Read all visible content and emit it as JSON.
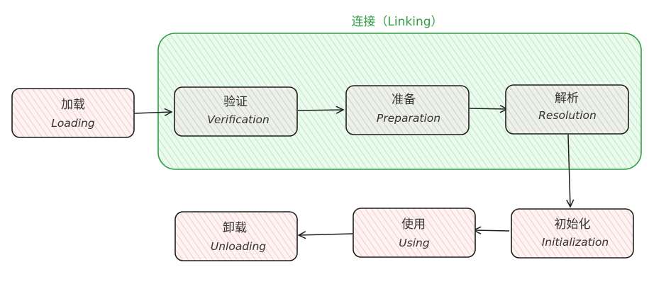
{
  "group": {
    "title": "连接（Linking）",
    "fill_color": "#b2f2bb",
    "stroke_color": "#2f9e44"
  },
  "nodes": {
    "loading": {
      "zh": "加载",
      "en": "Loading"
    },
    "verification": {
      "zh": "验证",
      "en": "Verification"
    },
    "preparation": {
      "zh": "准备",
      "en": "Preparation"
    },
    "resolution": {
      "zh": "解析",
      "en": "Resolution"
    },
    "initialization": {
      "zh": "初始化",
      "en": "Initialization"
    },
    "using": {
      "zh": "使用",
      "en": "Using"
    },
    "unloading": {
      "zh": "卸载",
      "en": "Unloading"
    }
  },
  "colors": {
    "pink_fill": "#ffc9c9",
    "gray_fill": "#d4d4c8",
    "stroke": "#1e1e1e"
  },
  "edges": [
    {
      "from": "loading",
      "to": "verification"
    },
    {
      "from": "verification",
      "to": "preparation"
    },
    {
      "from": "preparation",
      "to": "resolution"
    },
    {
      "from": "resolution",
      "to": "initialization"
    },
    {
      "from": "initialization",
      "to": "using"
    },
    {
      "from": "using",
      "to": "unloading"
    }
  ]
}
